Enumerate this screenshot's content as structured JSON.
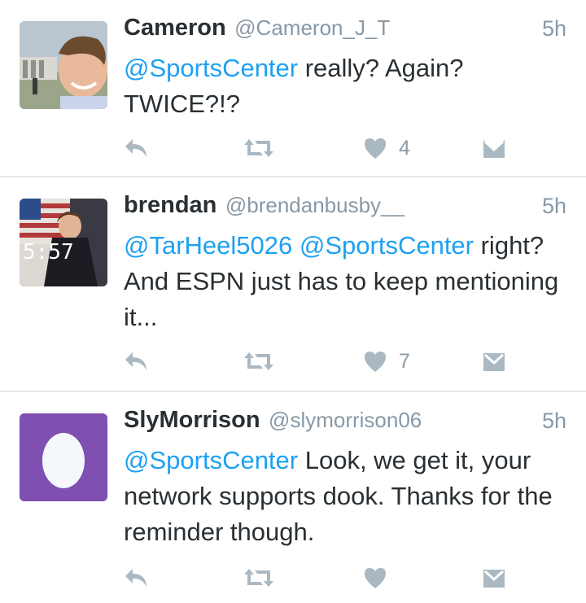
{
  "tweets": [
    {
      "display_name": "Cameron",
      "handle": "@Cameron_J_T",
      "time": "5h",
      "mention": "@SportsCenter",
      "text": " really? Again? TWICE?!?",
      "like_count": "4"
    },
    {
      "display_name": "brendan",
      "handle": "@brendanbusby__",
      "time": "5h",
      "mention1": "@TarHeel5026",
      "mention2": "@SportsCenter",
      "text": " right? And ESPN just has to keep mentioning it...",
      "like_count": "7"
    },
    {
      "display_name": "SlyMorrison",
      "handle": "@slymorrison06",
      "time": "5h",
      "mention": "@SportsCenter",
      "text": " Look, we get it, your network supports dook. Thanks for the reminder though.",
      "like_count": ""
    }
  ],
  "icons": {
    "reply": "reply-icon",
    "retweet": "retweet-icon",
    "like": "heart-icon",
    "dm": "direct-message-icon"
  },
  "colors": {
    "link": "#1da1f2",
    "text": "#292f33",
    "muted": "#8899a6",
    "icon": "#aab8c2",
    "egg_background": "#7f4fb1"
  }
}
